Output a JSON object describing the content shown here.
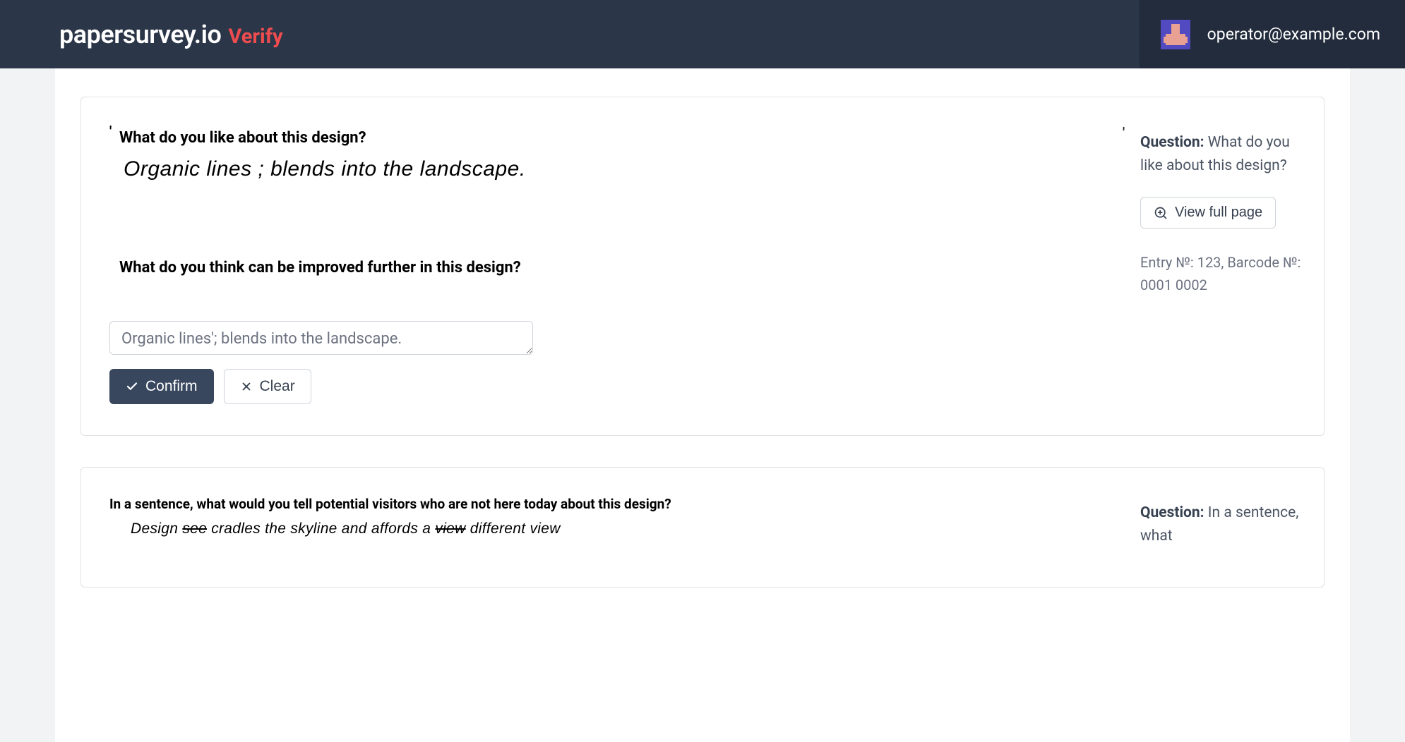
{
  "header": {
    "logo_primary": "papersurvey.io",
    "logo_secondary": "Verify",
    "user_email": "operator@example.com"
  },
  "card1": {
    "scan": {
      "prompt1": "What do you like about this design?",
      "handwriting": "Organic lines ; blends into the landscape.",
      "prompt2": "What do you think can be improved further in this design?"
    },
    "sidebar": {
      "question_label": "Question:",
      "question_text": "What do you like about this design?",
      "view_full_label": "View full page",
      "meta": "Entry №: 123, Barcode №: 0001 0002"
    },
    "transcription_value": "Organic lines'; blends into the landscape.",
    "buttons": {
      "confirm": "Confirm",
      "clear": "Clear"
    }
  },
  "card2": {
    "scan": {
      "prompt1": "In a sentence, what would you tell potential visitors who are not here today about this design?",
      "handwriting_pre": "Design ",
      "handwriting_strike1": "see",
      "handwriting_mid": " cradles the skyline and affords a ",
      "handwriting_strike2": "view",
      "handwriting_post": " different view"
    },
    "sidebar": {
      "question_label": "Question:",
      "question_text": "In a sentence, what"
    }
  }
}
